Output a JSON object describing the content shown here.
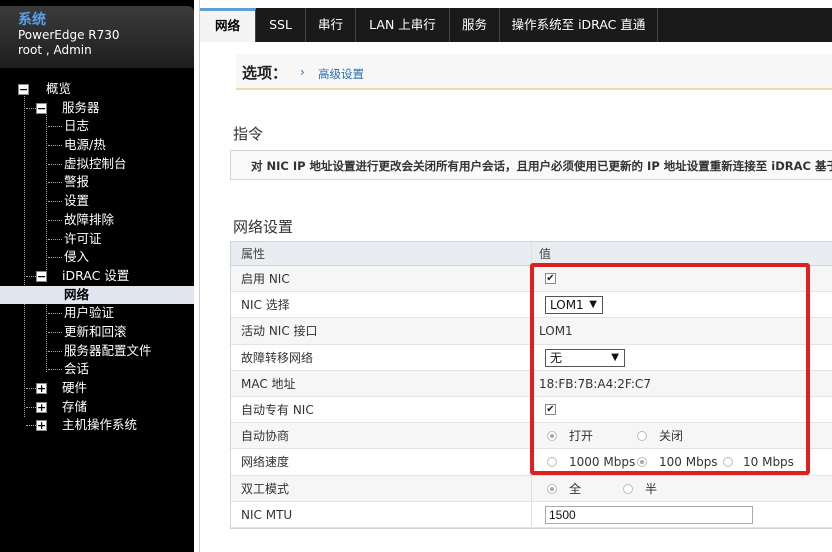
{
  "system": {
    "title": "系统",
    "model": "PowerEdge R730",
    "user": "root , Admin"
  },
  "tree": [
    {
      "label": "概览",
      "toggle": "−"
    },
    {
      "label": "服务器",
      "toggle": "−"
    },
    {
      "label": "日志"
    },
    {
      "label": "电源/热"
    },
    {
      "label": "虚拟控制台"
    },
    {
      "label": "警报"
    },
    {
      "label": "设置"
    },
    {
      "label": "故障排除"
    },
    {
      "label": "许可证"
    },
    {
      "label": "侵入"
    },
    {
      "label": "iDRAC 设置",
      "toggle": "−"
    },
    {
      "label": "网络"
    },
    {
      "label": "用户验证"
    },
    {
      "label": "更新和回滚"
    },
    {
      "label": "服务器配置文件"
    },
    {
      "label": "会话"
    },
    {
      "label": "硬件",
      "toggle": "+"
    },
    {
      "label": "存储",
      "toggle": "+"
    },
    {
      "label": "主机操作系统",
      "toggle": "+"
    }
  ],
  "tabs": [
    "网络",
    "SSL",
    "串行",
    "LAN 上串行",
    "服务",
    "操作系统至 iDRAC 直通"
  ],
  "options": {
    "label": "选项：",
    "chevron": "›",
    "link": "高级设置"
  },
  "instructions": {
    "title": "指令",
    "text": "对 NIC IP 地址设置进行更改会关闭所有用户会话，且用户必须使用已更新的 IP 地址设置重新连接至 iDRAC 基于 Web 的"
  },
  "network": {
    "title": "网络设置",
    "header_attr": "属性",
    "header_val": "值",
    "rows": {
      "enable_nic": {
        "label": "启用 NIC",
        "check": "✔"
      },
      "nic_select": {
        "label": "NIC 选择",
        "value": "LOM1"
      },
      "active_nic": {
        "label": "活动 NIC 接口",
        "value": "LOM1"
      },
      "failover": {
        "label": "故障转移网络",
        "value": "无"
      },
      "mac": {
        "label": "MAC 地址",
        "value": "18:FB:7B:A4:2F:C7"
      },
      "auto_dedicated": {
        "label": "自动专有 NIC",
        "check": "✔"
      },
      "auto_negotiate": {
        "label": "自动协商",
        "on": "打开",
        "off": "关闭"
      },
      "speed": {
        "label": "网络速度",
        "opt1": "1000 Mbps",
        "opt2": "100 Mbps",
        "opt3": "10 Mbps"
      },
      "duplex": {
        "label": "双工模式",
        "full": "全",
        "half": "半"
      },
      "mtu": {
        "label": "NIC MTU",
        "value": "1500"
      }
    }
  },
  "dropdown_arrow": "▼",
  "colors": {
    "accent": "#5e9fd6",
    "highlight_box": "#e01f1f",
    "title_blue": "#5aa0e8"
  }
}
